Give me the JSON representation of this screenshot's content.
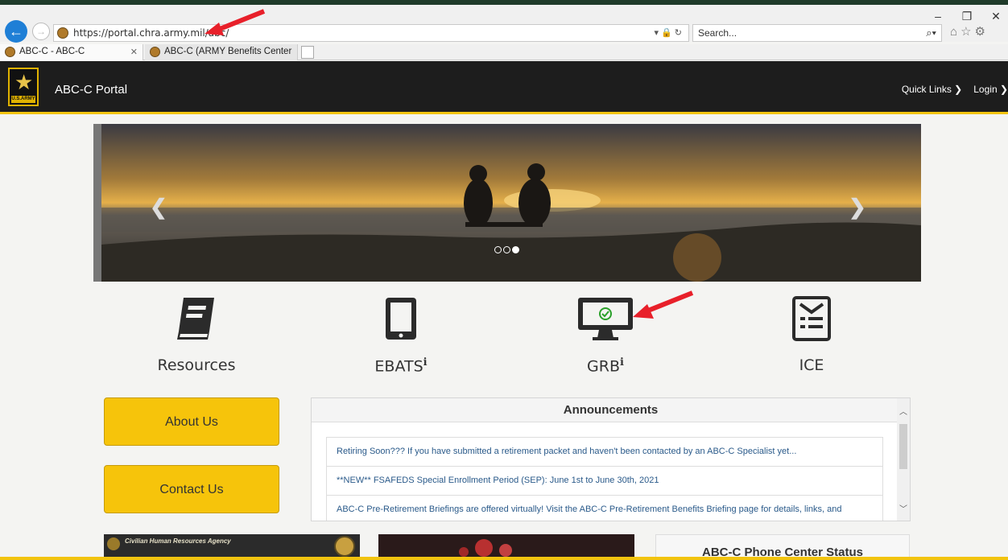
{
  "browser": {
    "url": "https://portal.chra.army.mil/abc/",
    "url_controls": "▾ 🔒 ↻",
    "search_placeholder": "Search...",
    "tabs": [
      {
        "label": "ABC-C - ABC-C"
      },
      {
        "label": "ABC-C (ARMY Benefits Center ..."
      }
    ]
  },
  "header": {
    "logo_text": "U.S.ARMY",
    "portal_name": "ABC-C Portal",
    "quick_links": "Quick Links ❯",
    "login": "Login ❯"
  },
  "carousel": {
    "slide_count": 3,
    "active_slide": 3
  },
  "features": [
    {
      "label": "Resources",
      "icon": "book-icon"
    },
    {
      "label": "EBATS",
      "icon": "tablet-icon",
      "info": "ℹ"
    },
    {
      "label": "GRB",
      "icon": "monitor-check-icon",
      "info": "ℹ"
    },
    {
      "label": "ICE",
      "icon": "feedback-form-icon"
    }
  ],
  "buttons": {
    "about": "About Us",
    "contact": "Contact Us"
  },
  "announcements": {
    "title": "Announcements",
    "items": [
      "Retiring Soon??? If you have submitted a retirement packet and haven't been contacted by an ABC-C Specialist yet...",
      "**NEW** FSAFEDS Special Enrollment Period (SEP): June 1st to June 30th, 2021",
      "ABC-C Pre-Retirement Briefings are offered virtually! Visit the ABC-C Pre-Retirement Benefits Briefing page for details, links, and"
    ]
  },
  "cards": {
    "chra_text": "Civilian Human Resources Agency",
    "phone_status_title": "ABC-C Phone Center Status"
  },
  "colors": {
    "accent_yellow": "#f6c40b",
    "header_bg": "#1d1d1d",
    "link_blue": "#2a5a8a",
    "annotation_red": "#e8202a"
  }
}
